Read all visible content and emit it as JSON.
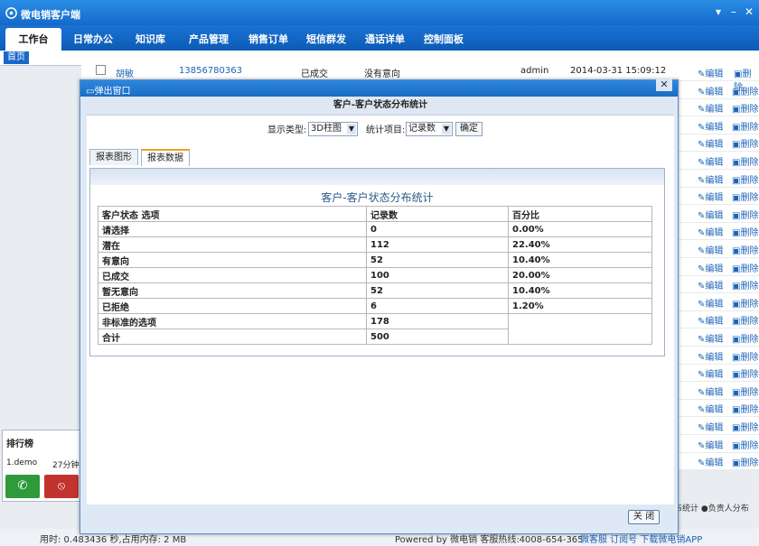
{
  "app": {
    "title": "微电销客户端",
    "controls": [
      "▾",
      "–",
      "✕"
    ]
  },
  "nav": {
    "items": [
      "工作台",
      "日常办公",
      "知识库",
      "产品管理",
      "销售订单",
      "短信群发",
      "通话详单",
      "控制面板"
    ]
  },
  "subtab": {
    "home": "首页"
  },
  "background_row": {
    "name": "胡敏",
    "phone": "13856780363",
    "status": "已成交",
    "intent": "没有意向",
    "user": "admin",
    "time": "2014-03-31 15:09:12",
    "edit": "编辑",
    "delete": "删除"
  },
  "left_panel": {
    "title": "排行榜",
    "row_name": "1.demo",
    "row_value": "27分钟"
  },
  "status": {
    "time": "用时: 0.483436 秒,占用内存: 2 MB",
    "powered": "Powered by 微电销  客服热线:4008-654-365",
    "links": "微客服   订阅号   下载微电销APP"
  },
  "bottom_right": "布统计  ●负责人分布",
  "modal": {
    "title": "弹出窗口",
    "close_x": "✕",
    "report_title": "客户-客户状态分布统计",
    "display_type_label": "显示类型:",
    "display_type_value": "3D柱图",
    "stat_item_label": "统计项目:",
    "stat_item_value": "记录数",
    "confirm": "确定",
    "tabs": [
      "报表图形",
      "报表数据"
    ],
    "table_title": "客户-客户状态分布统计",
    "headers": [
      "客户状态 选项",
      "记录数",
      "百分比"
    ],
    "rows": [
      [
        "请选择",
        "0",
        "0.00%"
      ],
      [
        "潜在",
        "112",
        "22.40%"
      ],
      [
        "有意向",
        "52",
        "10.40%"
      ],
      [
        "已成交",
        "100",
        "20.00%"
      ],
      [
        "暂无意向",
        "52",
        "10.40%"
      ],
      [
        "已拒绝",
        "6",
        "1.20%"
      ],
      [
        "非标准的选项",
        "178",
        ""
      ],
      [
        "合计",
        "500",
        ""
      ]
    ],
    "close_button": "关 闭"
  }
}
